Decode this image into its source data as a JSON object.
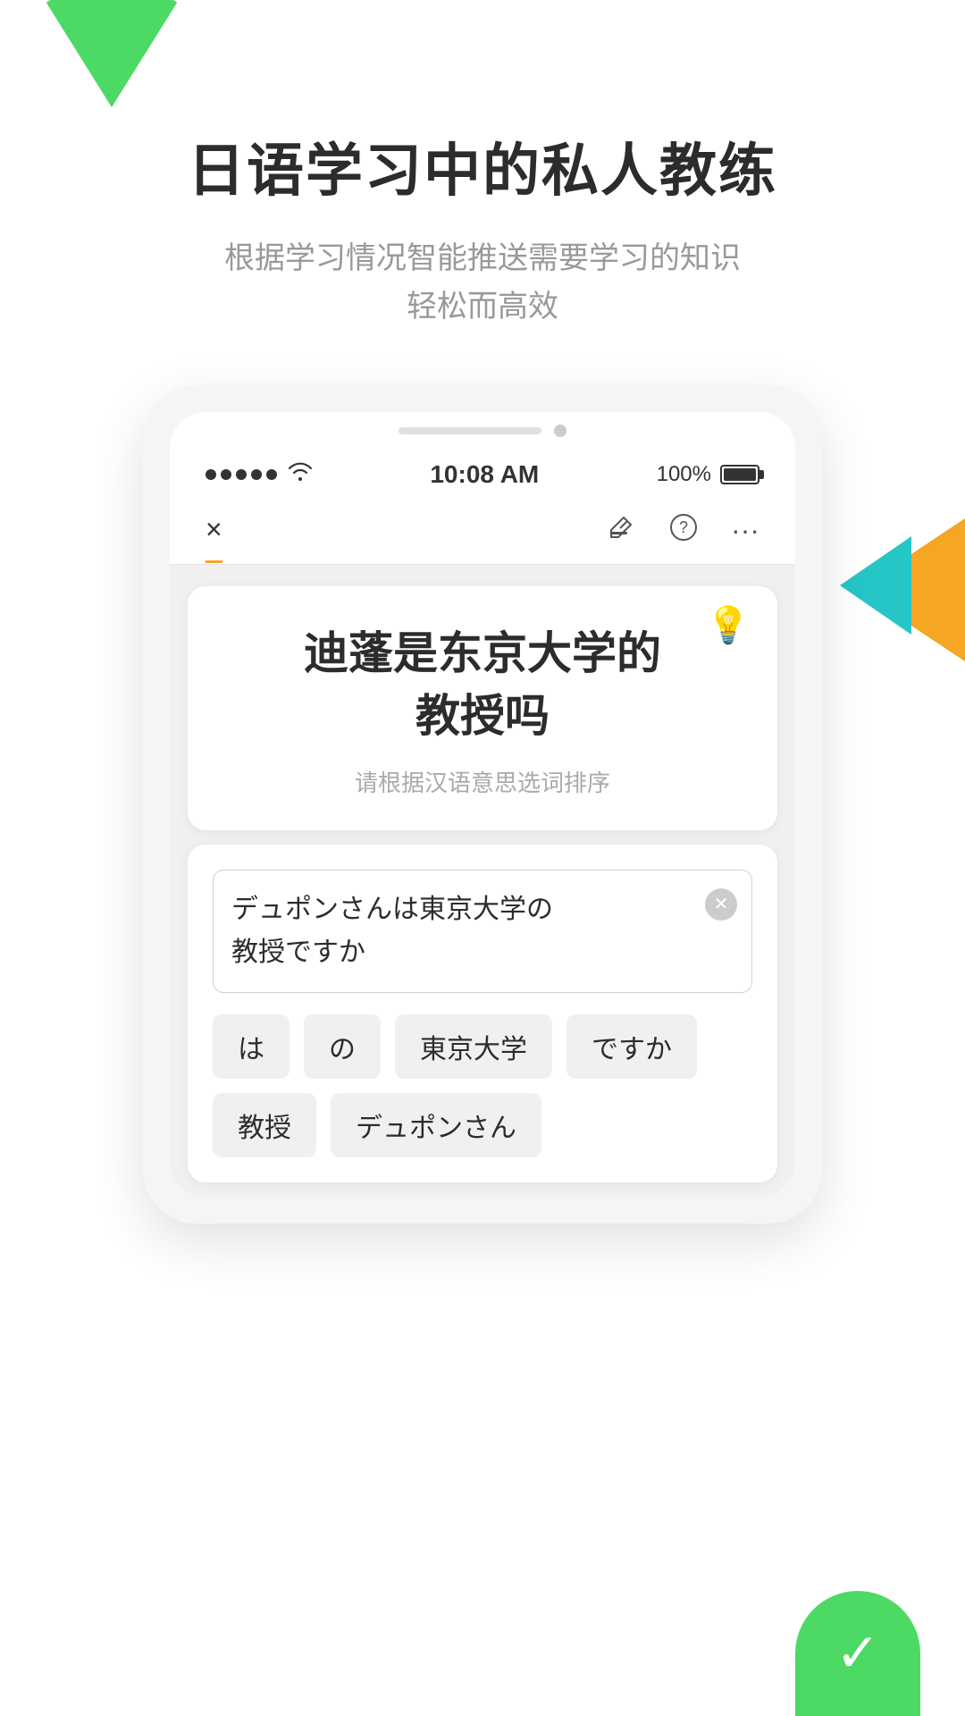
{
  "app": {
    "title": "日语学习中的私人教练",
    "subtitle_line1": "根据学习情况智能推送需要学习的知识",
    "subtitle_line2": "轻松而高效"
  },
  "status_bar": {
    "signal": "•••••",
    "wifi": "wifi",
    "time": "10:08 AM",
    "battery_percent": "100%"
  },
  "nav": {
    "close_icon": "×",
    "edit_icon": "✎",
    "help_icon": "?",
    "more_icon": "···"
  },
  "question": {
    "text_line1": "迪蓬是东京大学的",
    "text_line2": "教授吗",
    "hint": "请根据汉语意思选词排序",
    "bulb": "💡"
  },
  "answer": {
    "input_text_line1": "デュポンさんは東京大学の",
    "input_text_line2": "教授ですか",
    "clear_symbol": "×"
  },
  "word_chips": [
    {
      "text": "は"
    },
    {
      "text": "の"
    },
    {
      "text": "東京大学"
    },
    {
      "text": "ですか"
    },
    {
      "text": "教授"
    },
    {
      "text": "デュポンさん"
    }
  ],
  "bottom_check": "✓",
  "colors": {
    "green": "#4cd964",
    "orange": "#f5a623",
    "teal": "#26c6c6",
    "nav_underline": "#f5a623"
  }
}
